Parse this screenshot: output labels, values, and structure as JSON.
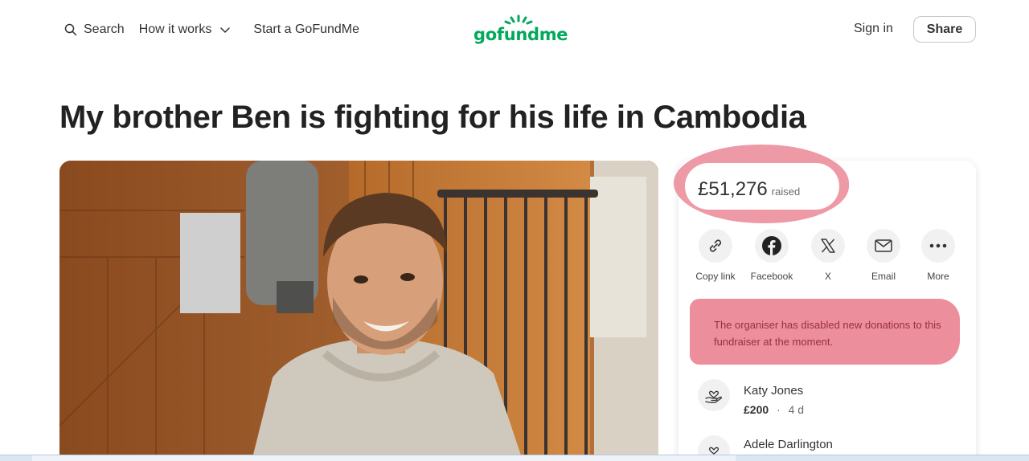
{
  "header": {
    "search_label": "Search",
    "how_it_works_label": "How it works",
    "start_label": "Start a GoFundMe",
    "logo_text": "gofundme",
    "sign_in_label": "Sign in",
    "share_label": "Share",
    "brand_color": "#02a95c"
  },
  "campaign": {
    "title": "My brother Ben is fighting for his life in Cambodia"
  },
  "donation_panel": {
    "amount_raised": "£51,276",
    "raised_label": "raised",
    "share_options": [
      {
        "label": "Copy link",
        "icon": "link-icon"
      },
      {
        "label": "Facebook",
        "icon": "facebook-icon"
      },
      {
        "label": "X",
        "icon": "x-icon"
      },
      {
        "label": "Email",
        "icon": "email-icon"
      },
      {
        "label": "More",
        "icon": "more-icon"
      }
    ],
    "notice": "The organiser has disabled new donations to this fundraiser at the moment.",
    "highlight_color": "#ec8e9c",
    "donations": [
      {
        "name": "Katy Jones",
        "amount": "£200",
        "separator": "·",
        "time": "4 d"
      },
      {
        "name": "Adele Darlington"
      }
    ]
  }
}
